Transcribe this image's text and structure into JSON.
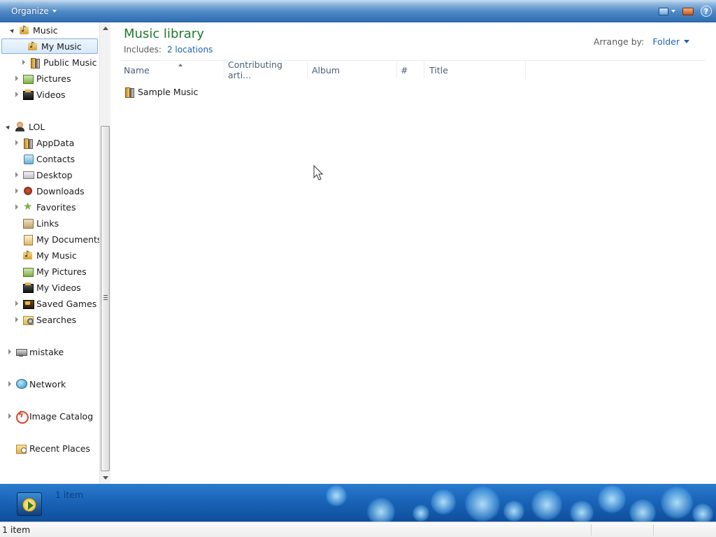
{
  "toolbar": {
    "organize_label": "Organize"
  },
  "nav": {
    "items": [
      {
        "label": "Music",
        "icon": "music-library-icon",
        "state": "expanded"
      },
      {
        "label": "My Music",
        "icon": "music-folder-icon",
        "state": "none",
        "selected": true
      },
      {
        "label": "Public Music",
        "icon": "folder-icon",
        "state": "collapsed"
      },
      {
        "label": "Pictures",
        "icon": "pictures-library-icon",
        "state": "collapsed"
      },
      {
        "label": "Videos",
        "icon": "videos-library-icon",
        "state": "collapsed"
      },
      {
        "label": "LOL",
        "icon": "user-folder-icon",
        "state": "expanded"
      },
      {
        "label": "AppData",
        "icon": "folder-icon",
        "state": "collapsed"
      },
      {
        "label": "Contacts",
        "icon": "contacts-icon",
        "state": "none"
      },
      {
        "label": "Desktop",
        "icon": "desktop-icon",
        "state": "collapsed"
      },
      {
        "label": "Downloads",
        "icon": "downloads-icon",
        "state": "collapsed"
      },
      {
        "label": "Favorites",
        "icon": "favorites-icon",
        "state": "collapsed"
      },
      {
        "label": "Links",
        "icon": "links-icon",
        "state": "none"
      },
      {
        "label": "My Documents",
        "icon": "documents-icon",
        "state": "none"
      },
      {
        "label": "My Music",
        "icon": "music-folder-icon",
        "state": "none"
      },
      {
        "label": "My Pictures",
        "icon": "pictures-folder-icon",
        "state": "none"
      },
      {
        "label": "My Videos",
        "icon": "videos-folder-icon",
        "state": "none"
      },
      {
        "label": "Saved Games",
        "icon": "saved-games-icon",
        "state": "collapsed"
      },
      {
        "label": "Searches",
        "icon": "searches-icon",
        "state": "collapsed"
      },
      {
        "label": "mistake",
        "icon": "computer-icon",
        "state": "collapsed"
      },
      {
        "label": "Network",
        "icon": "network-icon",
        "state": "collapsed"
      },
      {
        "label": "Image Catalog",
        "icon": "image-catalog-icon",
        "state": "collapsed"
      },
      {
        "label": "Recent Places",
        "icon": "recent-places-icon",
        "state": "none"
      }
    ]
  },
  "main": {
    "title": "Music library",
    "includes_label": "Includes:",
    "includes_link": "2 locations",
    "arrange_label": "Arrange by:",
    "arrange_value": "Folder",
    "columns": [
      "Name",
      "Contributing arti...",
      "Album",
      "#",
      "Title"
    ],
    "files": [
      {
        "name": "Sample Music",
        "icon": "music-folder-icon"
      }
    ]
  },
  "details": {
    "item_count": "1 item"
  },
  "statusbar": {
    "text": "1 item"
  },
  "colors": {
    "title_green": "#1e7a2e",
    "link_blue": "#1f63b5",
    "toolbar_blue": "#2f6eb2",
    "details_blue": "#1a64b7"
  }
}
